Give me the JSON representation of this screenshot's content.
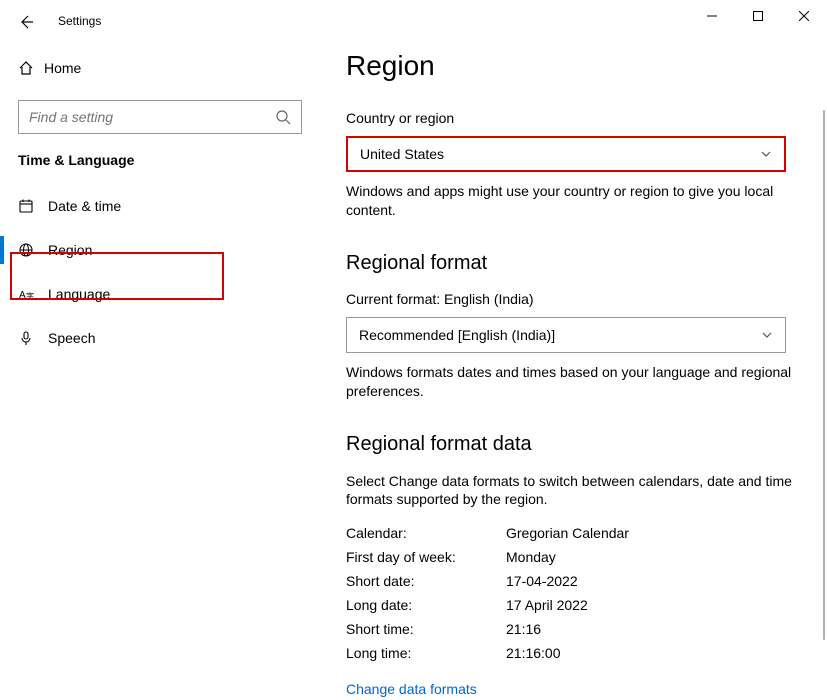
{
  "window": {
    "title": "Settings"
  },
  "sidebar": {
    "home": "Home",
    "search_placeholder": "Find a setting",
    "category": "Time & Language",
    "items": [
      {
        "label": "Date & time"
      },
      {
        "label": "Region"
      },
      {
        "label": "Language"
      },
      {
        "label": "Speech"
      }
    ]
  },
  "page": {
    "title": "Region",
    "country_label": "Country or region",
    "country_value": "United States",
    "country_desc": "Windows and apps might use your country or region to give you local content.",
    "regional_format_heading": "Regional format",
    "current_format_label": "Current format: English (India)",
    "format_dropdown_value": "Recommended [English (India)]",
    "format_desc": "Windows formats dates and times based on your language and regional preferences.",
    "data_heading": "Regional format data",
    "data_desc": "Select Change data formats to switch between calendars, date and time formats supported by the region.",
    "rows": [
      {
        "key": "Calendar:",
        "val": "Gregorian Calendar"
      },
      {
        "key": "First day of week:",
        "val": "Monday"
      },
      {
        "key": "Short date:",
        "val": "17-04-2022"
      },
      {
        "key": "Long date:",
        "val": "17 April 2022"
      },
      {
        "key": "Short time:",
        "val": "21:16"
      },
      {
        "key": "Long time:",
        "val": "21:16:00"
      }
    ],
    "change_link": "Change data formats"
  }
}
